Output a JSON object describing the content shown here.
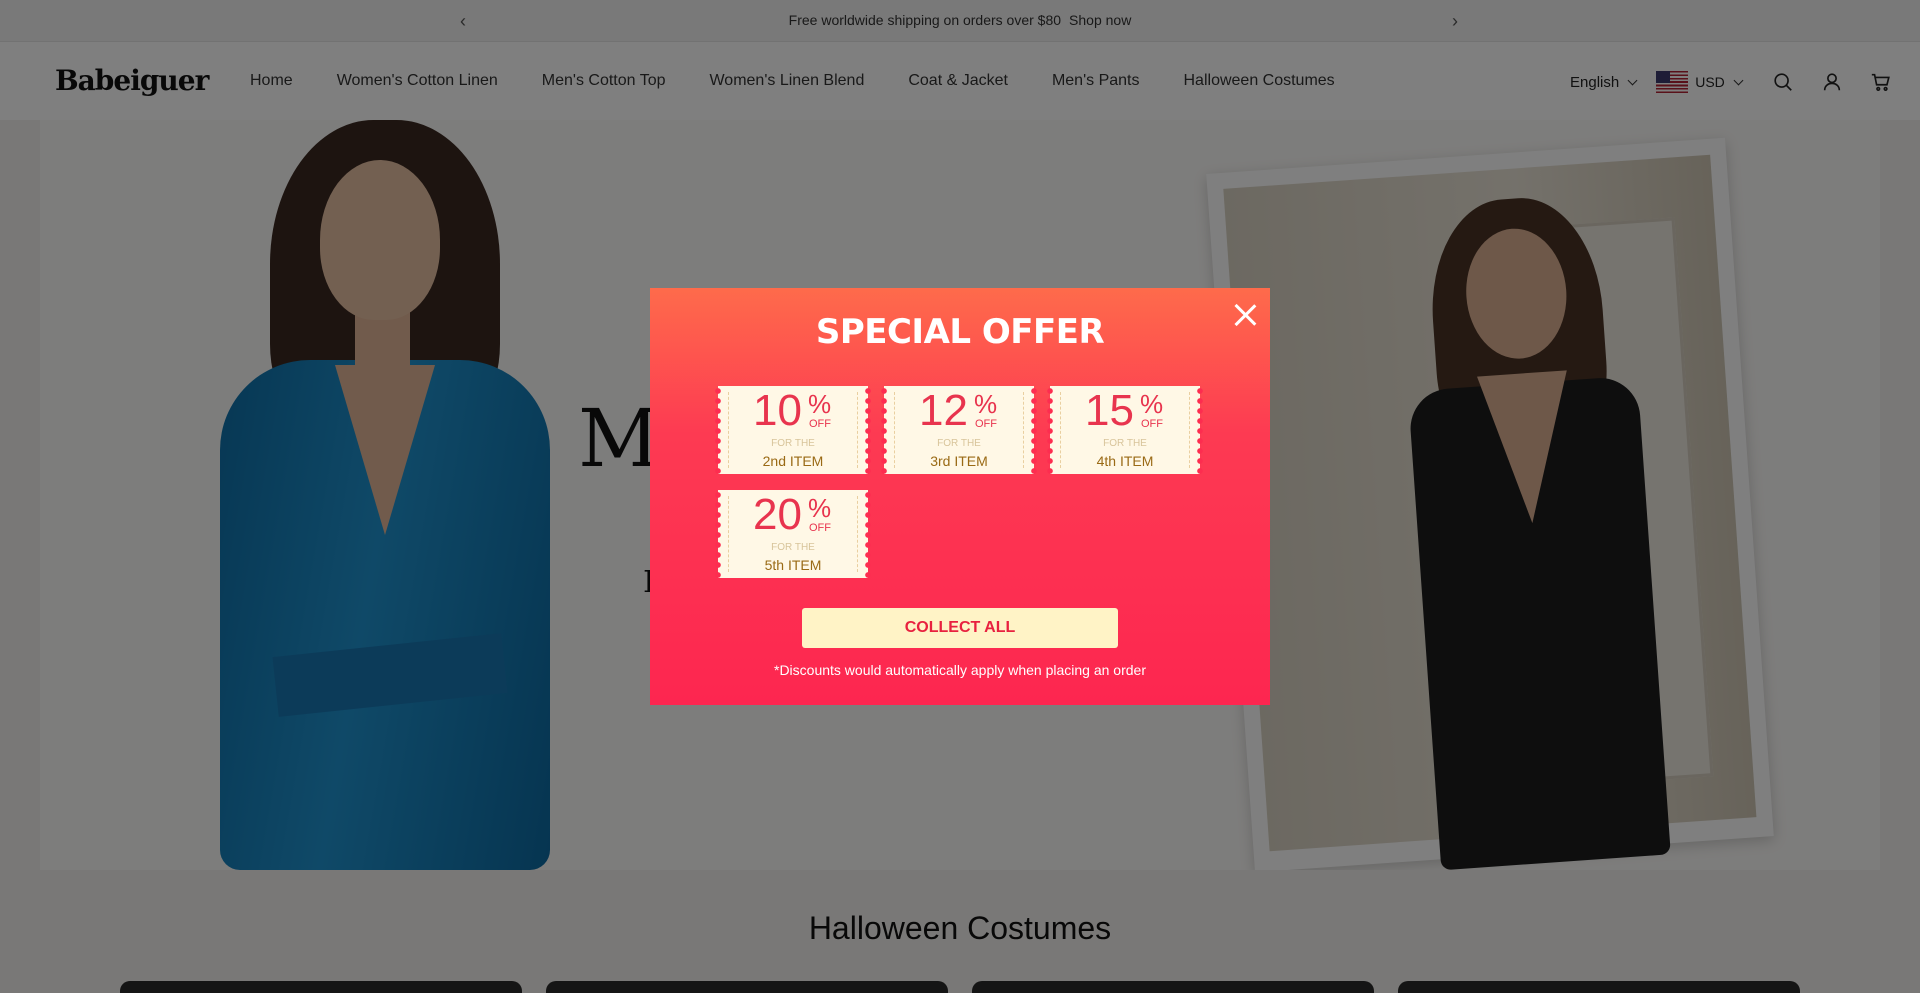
{
  "announcement": {
    "text": "Free worldwide shipping on orders over $80",
    "link": "Shop now",
    "prev": "‹",
    "next": "›"
  },
  "header": {
    "logo": "Babeiguer",
    "nav": [
      "Home",
      "Women's Cotton Linen",
      "Men's Cotton Top",
      "Women's Linen Blend",
      "Coat & Jacket",
      "Men's Pants",
      "Halloween Costumes"
    ],
    "language": "English",
    "currency": "USD",
    "icons": [
      "search-icon",
      "account-icon",
      "cart-icon"
    ]
  },
  "hero": {
    "title": "M",
    "subtitle": "I"
  },
  "section": {
    "title": "Halloween Costumes"
  },
  "modal": {
    "title": "SPECIAL OFFER",
    "coupons": [
      {
        "value": "10",
        "pct": "%",
        "off": "OFF",
        "for": "FOR THE",
        "item": "2nd ITEM"
      },
      {
        "value": "12",
        "pct": "%",
        "off": "OFF",
        "for": "FOR THE",
        "item": "3rd ITEM"
      },
      {
        "value": "15",
        "pct": "%",
        "off": "OFF",
        "for": "FOR THE",
        "item": "4th ITEM"
      },
      {
        "value": "20",
        "pct": "%",
        "off": "OFF",
        "for": "FOR THE",
        "item": "5th ITEM"
      }
    ],
    "button": "COLLECT ALL",
    "note": "*Discounts would automatically apply when placing an order"
  },
  "colors": {
    "modal_top": "#fe6b4b",
    "modal_bottom": "#fd2650",
    "coupon_bg": "#fff8e6",
    "button_bg": "#fff3c6",
    "accent": "#e8344e"
  }
}
